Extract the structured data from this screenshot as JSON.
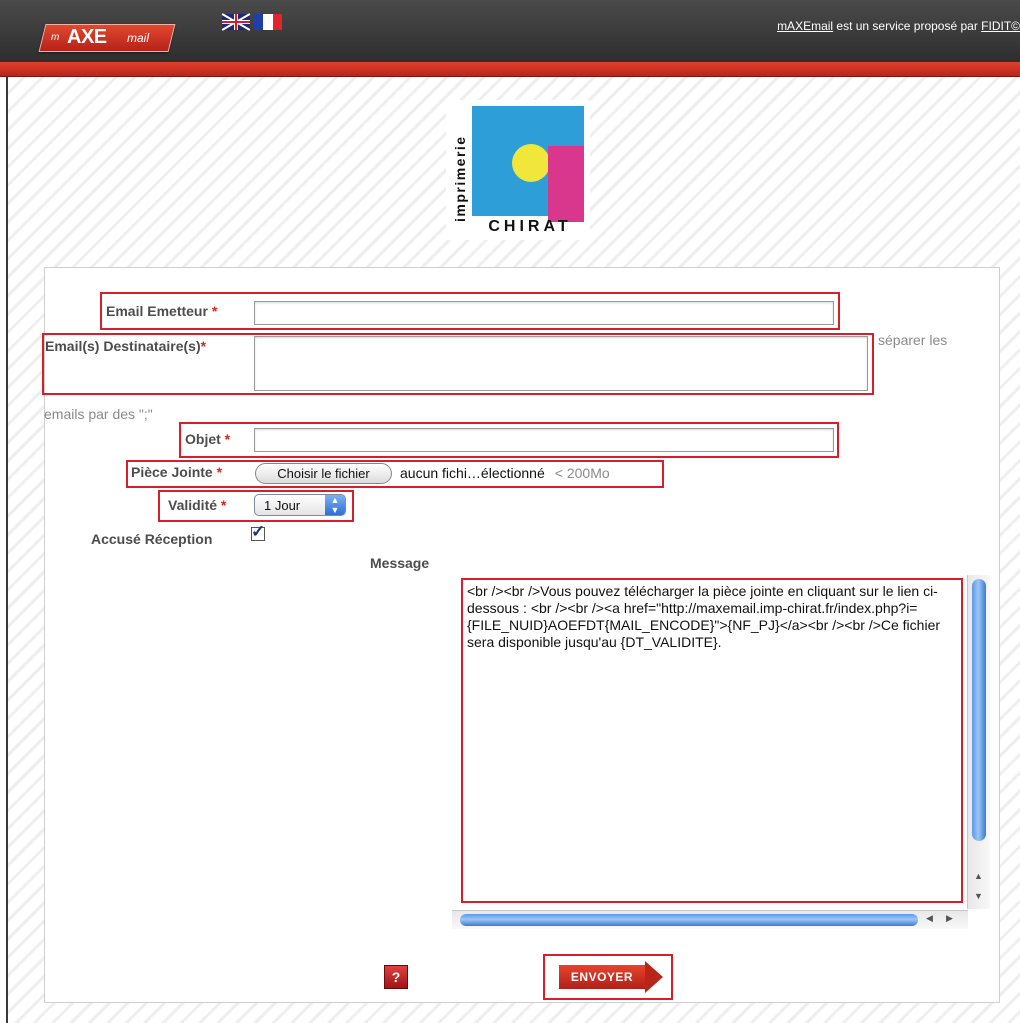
{
  "header": {
    "logo_prefix": "m",
    "logo_main": "AXE",
    "logo_suffix": "mail",
    "credit_link": "mAXEmail",
    "credit_text": " est un service proposé par ",
    "credit_company": "FIDIT©",
    "flags": [
      "uk-flag-icon",
      "fr-flag-icon"
    ],
    "colors": {
      "topbar": "#333333",
      "redband": "#c9301f"
    }
  },
  "brand": {
    "vertical_text": "imprimerie",
    "name": "CHIRAT",
    "colors": {
      "blue": "#2e9ed9",
      "yellow": "#f1e73a",
      "pink": "#d9378e"
    }
  },
  "form": {
    "email_sender_label": "Email Emetteur",
    "email_sender_value": "",
    "recipients_label": "Email(s) Destinataire(s)",
    "recipients_value": "",
    "recipients_hint_a": "séparer les",
    "recipients_hint_b": "emails par des \";\"",
    "subject_label": "Objet",
    "subject_value": "",
    "attachment_label": "Pièce Jointe",
    "attachment_button": "Choisir le fichier",
    "attachment_status": "aucun fichi…électionné",
    "attachment_limit": "< 200Mo",
    "validity_label": "Validité",
    "validity_value": "1 Jour",
    "receipt_label": "Accusé Réception",
    "receipt_checked": true,
    "message_label": "Message",
    "message_value": "<br /><br />Vous pouvez télécharger la pièce jointe en cliquant sur le lien ci-dessous : <br /><br /><a href=\"http://maxemail.imp-chirat.fr/index.php?i={FILE_NUID}AOEFDT{MAIL_ENCODE}\">{NF_PJ}</a><br /><br />Ce fichier sera disponible jusqu'au {DT_VALIDITE}.",
    "required_mark": "*",
    "help_label": "?",
    "send_label": "ENVOYER"
  }
}
